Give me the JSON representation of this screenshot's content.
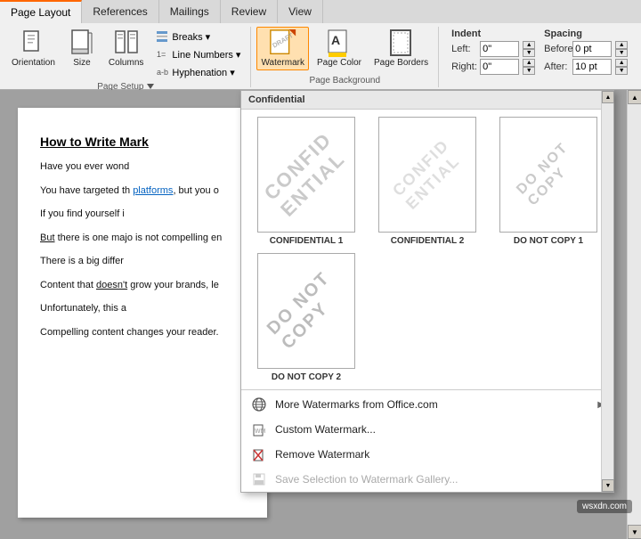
{
  "tabs": [
    {
      "label": "Page Layout",
      "active": true
    },
    {
      "label": "References",
      "active": false
    },
    {
      "label": "Mailings",
      "active": false
    },
    {
      "label": "Review",
      "active": false
    },
    {
      "label": "View",
      "active": false
    }
  ],
  "ribbon": {
    "groups": [
      {
        "name": "page_setup",
        "label": "Page Setup",
        "buttons": [
          {
            "id": "orientation",
            "label": "Orientation"
          },
          {
            "id": "size",
            "label": "Size"
          },
          {
            "id": "columns",
            "label": "Columns"
          }
        ],
        "small_buttons": [
          {
            "id": "breaks",
            "label": "Breaks ▾"
          },
          {
            "id": "line_numbers",
            "label": "Line Numbers ▾"
          },
          {
            "id": "hyphenation",
            "label": "Hyphenation ▾"
          }
        ]
      },
      {
        "name": "page_background",
        "label": "Page Background",
        "buttons": [
          {
            "id": "watermark",
            "label": "Watermark",
            "active": true
          },
          {
            "id": "page_color",
            "label": "Page Color"
          },
          {
            "id": "page_borders",
            "label": "Page Borders"
          }
        ]
      }
    ],
    "indent": {
      "label": "Indent",
      "left_label": "Left:",
      "left_value": "0\"",
      "right_label": "Right:",
      "right_value": "0\""
    },
    "spacing": {
      "label": "Spacing",
      "before_label": "Before:",
      "before_value": "0 pt",
      "after_label": "After:",
      "after_value": "10 pt"
    }
  },
  "document": {
    "title": "How to Write Mark",
    "paragraphs": [
      "Have you ever wond",
      "You have targeted th platforms, but you o",
      "If you find yourself i",
      "But there is one majo is not compelling en",
      "There is a big differ",
      "Content that doesn't grow your brands, le",
      "Unfortunately, this a",
      "Compelling content changes your reader."
    ],
    "link_text": "platforms"
  },
  "watermark_panel": {
    "header": "Confidential",
    "scrollbar_visible": true,
    "items": [
      {
        "id": "confidential1",
        "watermark_text": "CONFIDENTIAL",
        "style": "diagonal",
        "label": "CONFIDENTIAL 1"
      },
      {
        "id": "confidential2",
        "watermark_text": "CONFIDENTIAL",
        "style": "diagonal_light",
        "label": "CONFIDENTIAL 2"
      },
      {
        "id": "do_not_copy1",
        "watermark_text": "DO NOT COPY",
        "style": "diagonal",
        "label": "DO NOT COPY 1"
      },
      {
        "id": "do_not_copy2",
        "watermark_text": "DO NOT COPY",
        "style": "diagonal_large",
        "label": "DO NOT COPY 2"
      },
      {
        "id": "empty1",
        "label": ""
      },
      {
        "id": "empty2",
        "label": ""
      }
    ],
    "menu_items": [
      {
        "id": "more_watermarks",
        "label": "More Watermarks from Office.com",
        "icon": "globe",
        "has_arrow": true,
        "disabled": false
      },
      {
        "id": "custom_watermark",
        "label": "Custom Watermark...",
        "icon": "custom",
        "disabled": false
      },
      {
        "id": "remove_watermark",
        "label": "Remove Watermark",
        "icon": "remove",
        "disabled": false
      },
      {
        "id": "save_selection",
        "label": "Save Selection to Watermark Gallery...",
        "icon": "save",
        "disabled": true
      }
    ]
  },
  "status_bar": {
    "text": "wsxdn.com"
  }
}
